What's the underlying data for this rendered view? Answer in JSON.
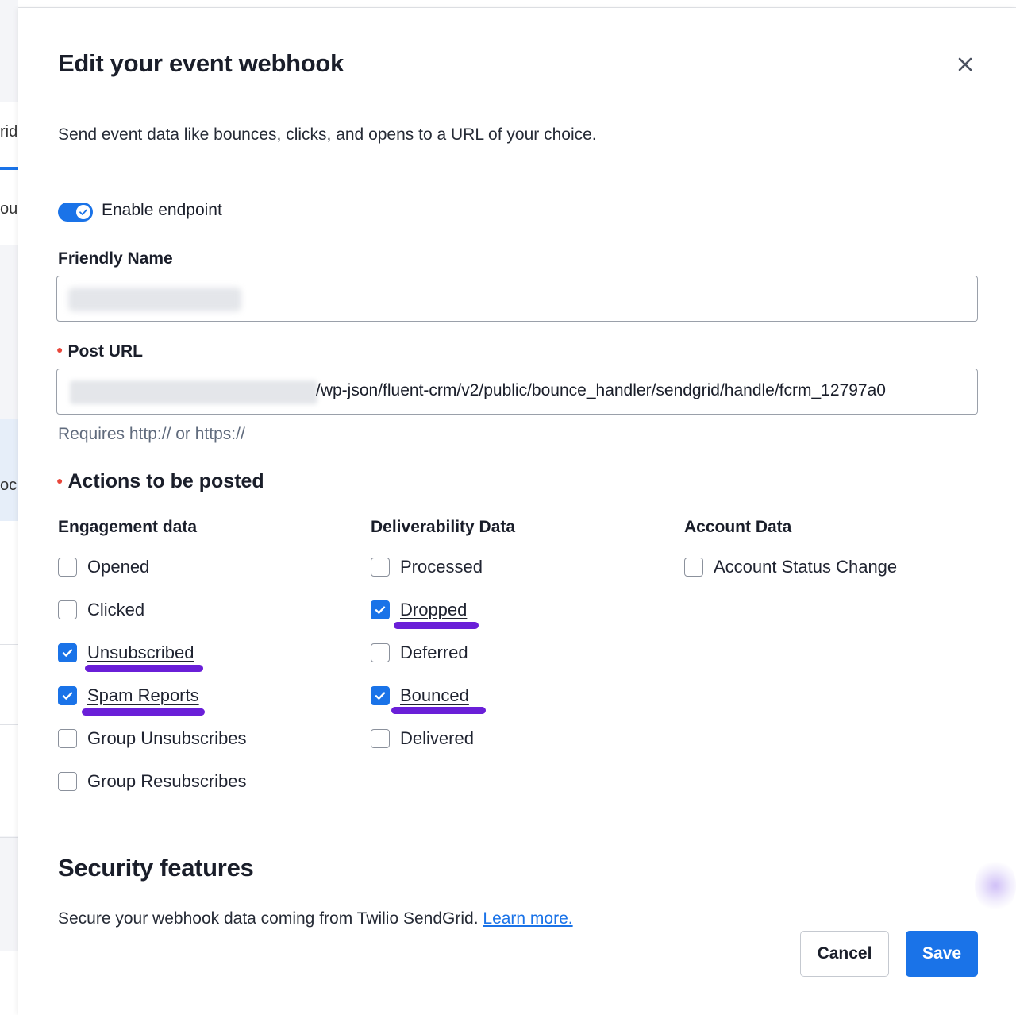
{
  "background": {
    "fragments": [
      "rid",
      "ou",
      "oc"
    ]
  },
  "modal": {
    "title": "Edit your event webhook",
    "subtitle": "Send event data like bounces, clicks, and opens to a URL of your choice.",
    "close_icon": "close-icon",
    "enable_endpoint": {
      "label": "Enable endpoint",
      "enabled": true
    },
    "friendly_name": {
      "label": "Friendly Name",
      "value": ""
    },
    "post_url": {
      "label": "Post URL",
      "required": true,
      "value_visible": "/wp-json/fluent-crm/v2/public/bounce_handler/sendgrid/handle/fcrm_12797a0",
      "hint": "Requires http:// or https://"
    },
    "actions_title": "Actions to be posted",
    "columns": [
      {
        "heading": "Engagement data",
        "items": [
          {
            "label": "Opened",
            "checked": false
          },
          {
            "label": "Clicked",
            "checked": false
          },
          {
            "label": "Unsubscribed",
            "checked": true
          },
          {
            "label": "Spam Reports",
            "checked": true
          },
          {
            "label": "Group Unsubscribes",
            "checked": false
          },
          {
            "label": "Group Resubscribes",
            "checked": false
          }
        ]
      },
      {
        "heading": "Deliverability Data",
        "items": [
          {
            "label": "Processed",
            "checked": false
          },
          {
            "label": "Dropped",
            "checked": true
          },
          {
            "label": "Deferred",
            "checked": false
          },
          {
            "label": "Bounced",
            "checked": true
          },
          {
            "label": "Delivered",
            "checked": false
          }
        ]
      },
      {
        "heading": "Account Data",
        "items": [
          {
            "label": "Account Status Change",
            "checked": false
          }
        ]
      }
    ],
    "security": {
      "title": "Security features",
      "text": "Secure your webhook data coming from Twilio SendGrid.",
      "link": "Learn more."
    },
    "buttons": {
      "cancel": "Cancel",
      "save": "Save"
    }
  },
  "colors": {
    "accent": "#1a73e8",
    "highlight_marker": "#6a1fd8",
    "required_dot": "#e8473b"
  }
}
